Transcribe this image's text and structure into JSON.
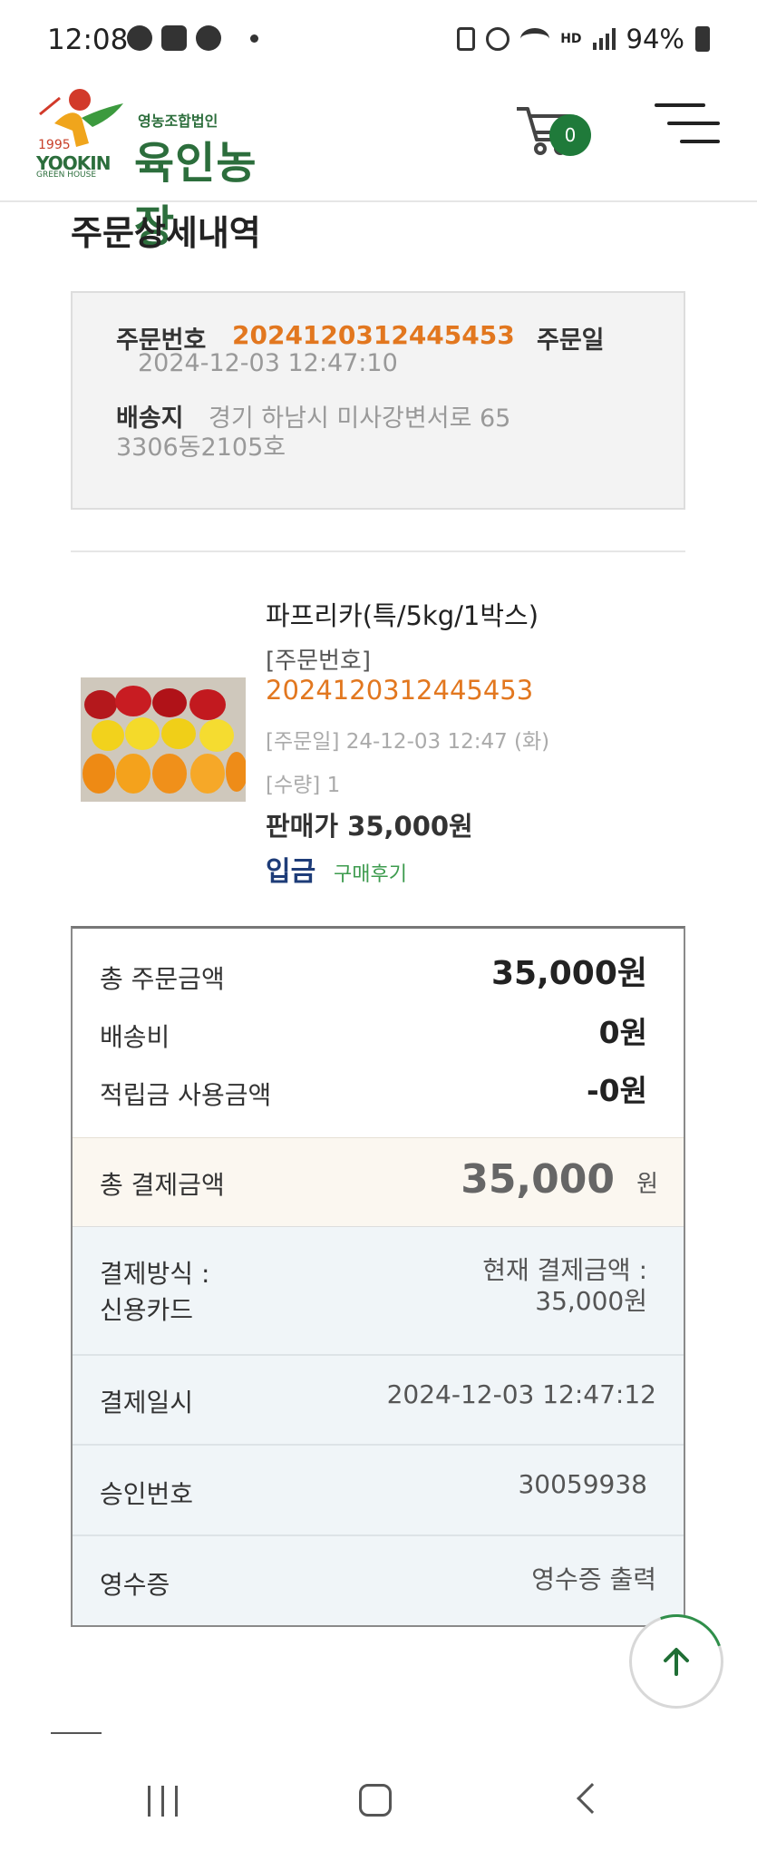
{
  "status_bar": {
    "time": "12:08",
    "left_icons": [
      "talk-icon",
      "gallery-icon",
      "pill-icon",
      "dot-icon"
    ],
    "right_icons": [
      "battery-saver-icon",
      "alarm-icon",
      "wifi-icon",
      "hd-voice-icon",
      "signal-icon",
      "battery-icon"
    ],
    "hd_label": "HD",
    "battery": "94%"
  },
  "header": {
    "logo_sub": "영농조합법인",
    "logo_name": "육인농장",
    "logo_year": "1995",
    "logo_en": "YOOKIN",
    "logo_en2": "GREEN HOUSE",
    "cart_count": "0",
    "accent": "#1f7a3a"
  },
  "page": {
    "title": "주문상세내역"
  },
  "order_info": {
    "order_no_label": "주문번호",
    "order_no": "2024120312445453",
    "order_date_label": "주문일",
    "order_date": "2024-12-03 12:47:10",
    "shipping_label": "배송지",
    "shipping_line1": "경기 하남시 미사강변서로 65",
    "shipping_line2": "3306동2105호"
  },
  "product": {
    "title": "파프리카(특/5kg/1박스)",
    "order_no_label": "[주문번호]",
    "order_no": "2024120312445453",
    "order_date": "[주문일] 24-12-03 12:47 (화)",
    "quantity": "[수량] 1",
    "price": "판매가 35,000원",
    "status": "입금",
    "review_link": "구매후기"
  },
  "summary": {
    "total_order_label": "총 주문금액",
    "total_order_value": "35,000원",
    "shipping_label": "배송비",
    "shipping_value": "0원",
    "points_label": "적립금 사용금액",
    "points_value": "-0원",
    "total_pay_label": "총 결제금액",
    "total_pay_value": "35,000",
    "total_pay_unit": "원",
    "method_label": "결제방식 :",
    "method_value": "신용카드",
    "current_label": "현재 결제금액 :",
    "current_value": "35,000원",
    "paid_at_label": "결제일시",
    "paid_at_value": "2024-12-03 12:47:12",
    "approval_label": "승인번호",
    "approval_value": "30059938",
    "receipt_label": "영수증",
    "receipt_button": "영수증 출력"
  },
  "nav": {
    "icons": [
      "recent-apps-icon",
      "home-icon",
      "back-icon"
    ]
  }
}
